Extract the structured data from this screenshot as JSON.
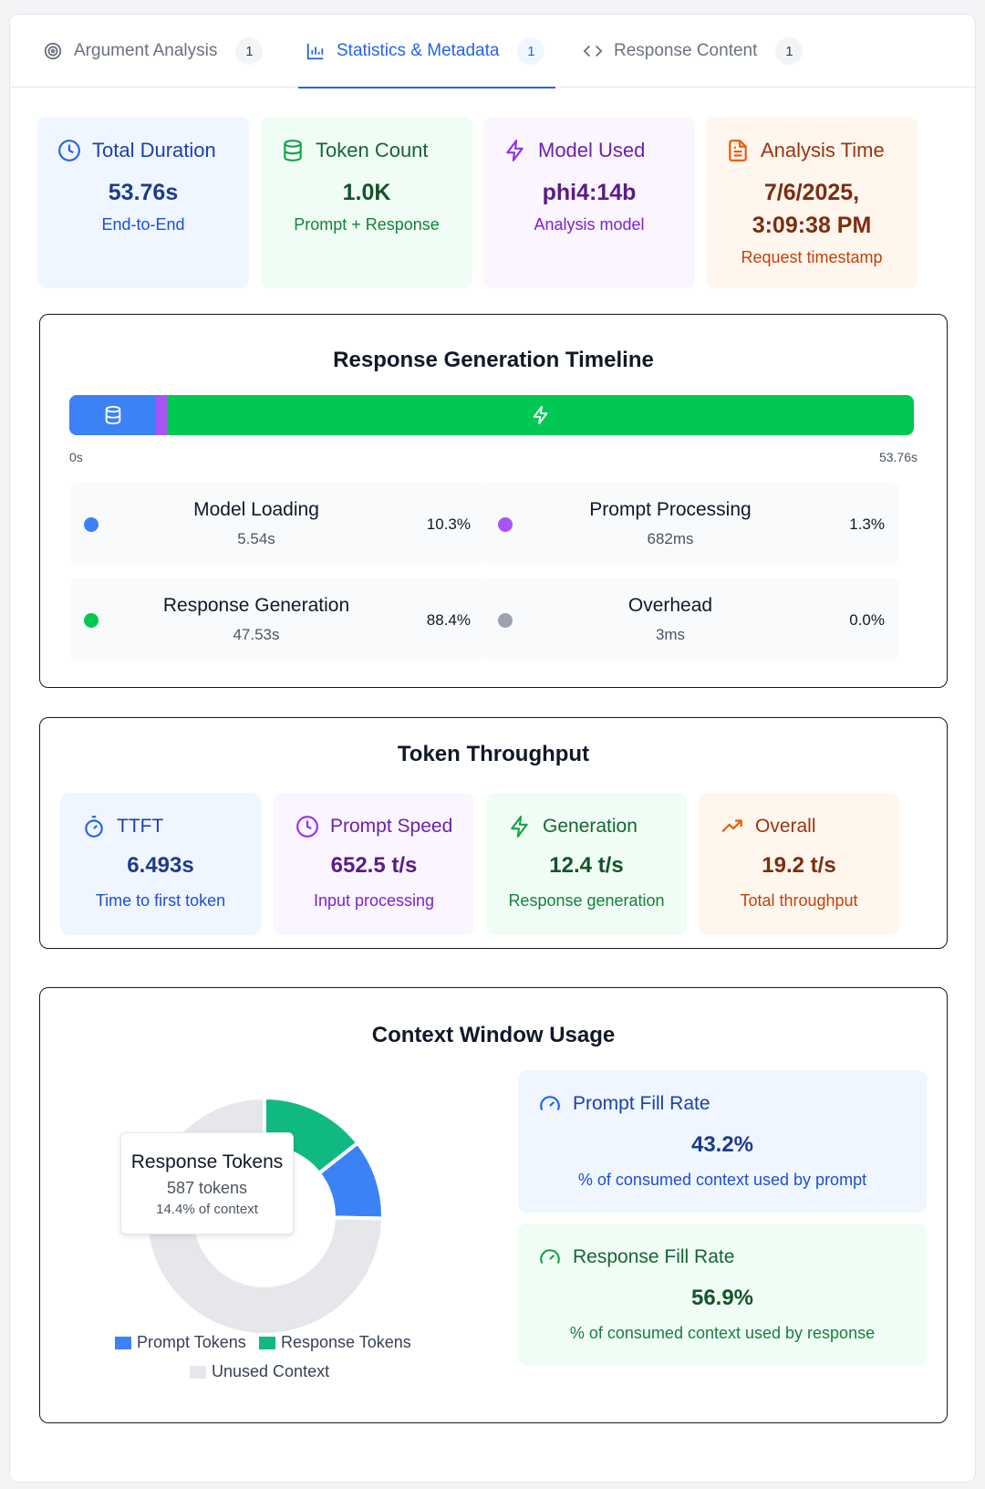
{
  "tabs": [
    {
      "label": "Argument Analysis",
      "count": "1",
      "icon": "target-icon"
    },
    {
      "label": "Statistics & Metadata",
      "count": "1",
      "icon": "bar-chart-icon"
    },
    {
      "label": "Response Content",
      "count": "1",
      "icon": "code-icon"
    }
  ],
  "summary": {
    "duration": {
      "title": "Total Duration",
      "value": "53.76s",
      "sub": "End-to-End"
    },
    "tokens": {
      "title": "Token Count",
      "value": "1.0K",
      "sub": "Prompt + Response"
    },
    "model": {
      "title": "Model Used",
      "value": "phi4:14b",
      "sub": "Analysis model"
    },
    "time": {
      "title": "Analysis Time",
      "value_line1": "7/6/2025,",
      "value_line2": "3:09:38 PM",
      "sub": "Request timestamp"
    }
  },
  "timeline": {
    "title": "Response Generation Timeline",
    "start_label": "0s",
    "end_label": "53.76s",
    "phases": [
      {
        "name": "Model Loading",
        "duration": "5.54s",
        "percent": "10.3%",
        "fraction": 0.103,
        "color": "#3b82f6"
      },
      {
        "name": "Prompt Processing",
        "duration": "682ms",
        "percent": "1.3%",
        "fraction": 0.013,
        "color": "#a855f7"
      },
      {
        "name": "Response Generation",
        "duration": "47.53s",
        "percent": "88.4%",
        "fraction": 0.884,
        "color": "#00c853"
      },
      {
        "name": "Overhead",
        "duration": "3ms",
        "percent": "0.0%",
        "fraction": 0.0,
        "color": "#9ca3af"
      }
    ]
  },
  "throughput": {
    "title": "Token Throughput",
    "ttft": {
      "title": "TTFT",
      "value": "6.493s",
      "sub": "Time to first token"
    },
    "prompt_speed": {
      "title": "Prompt Speed",
      "value": "652.5 t/s",
      "sub": "Input processing"
    },
    "generation": {
      "title": "Generation",
      "value": "12.4 t/s",
      "sub": "Response generation"
    },
    "overall": {
      "title": "Overall",
      "value": "19.2 t/s",
      "sub": "Total throughput"
    }
  },
  "context": {
    "title": "Context Window Usage",
    "tooltip": {
      "title": "Response Tokens",
      "tokens": "587 tokens",
      "share": "14.4% of context"
    },
    "prompt_fill": {
      "title": "Prompt Fill Rate",
      "value": "43.2%",
      "sub": "% of consumed context used by prompt"
    },
    "response_fill": {
      "title": "Response Fill Rate",
      "value": "56.9%",
      "sub": "% of consumed context used by response"
    },
    "legend": {
      "prompt": "Prompt Tokens",
      "response": "Response Tokens",
      "unused": "Unused Context"
    }
  },
  "chart_data": {
    "type": "pie",
    "categories": [
      "Prompt Tokens",
      "Response Tokens",
      "Unused Context"
    ],
    "values": [
      10.9,
      14.4,
      74.7
    ],
    "colors": [
      "#3b82f6",
      "#10b981",
      "#e5e7eb"
    ],
    "legend": "bottom"
  }
}
